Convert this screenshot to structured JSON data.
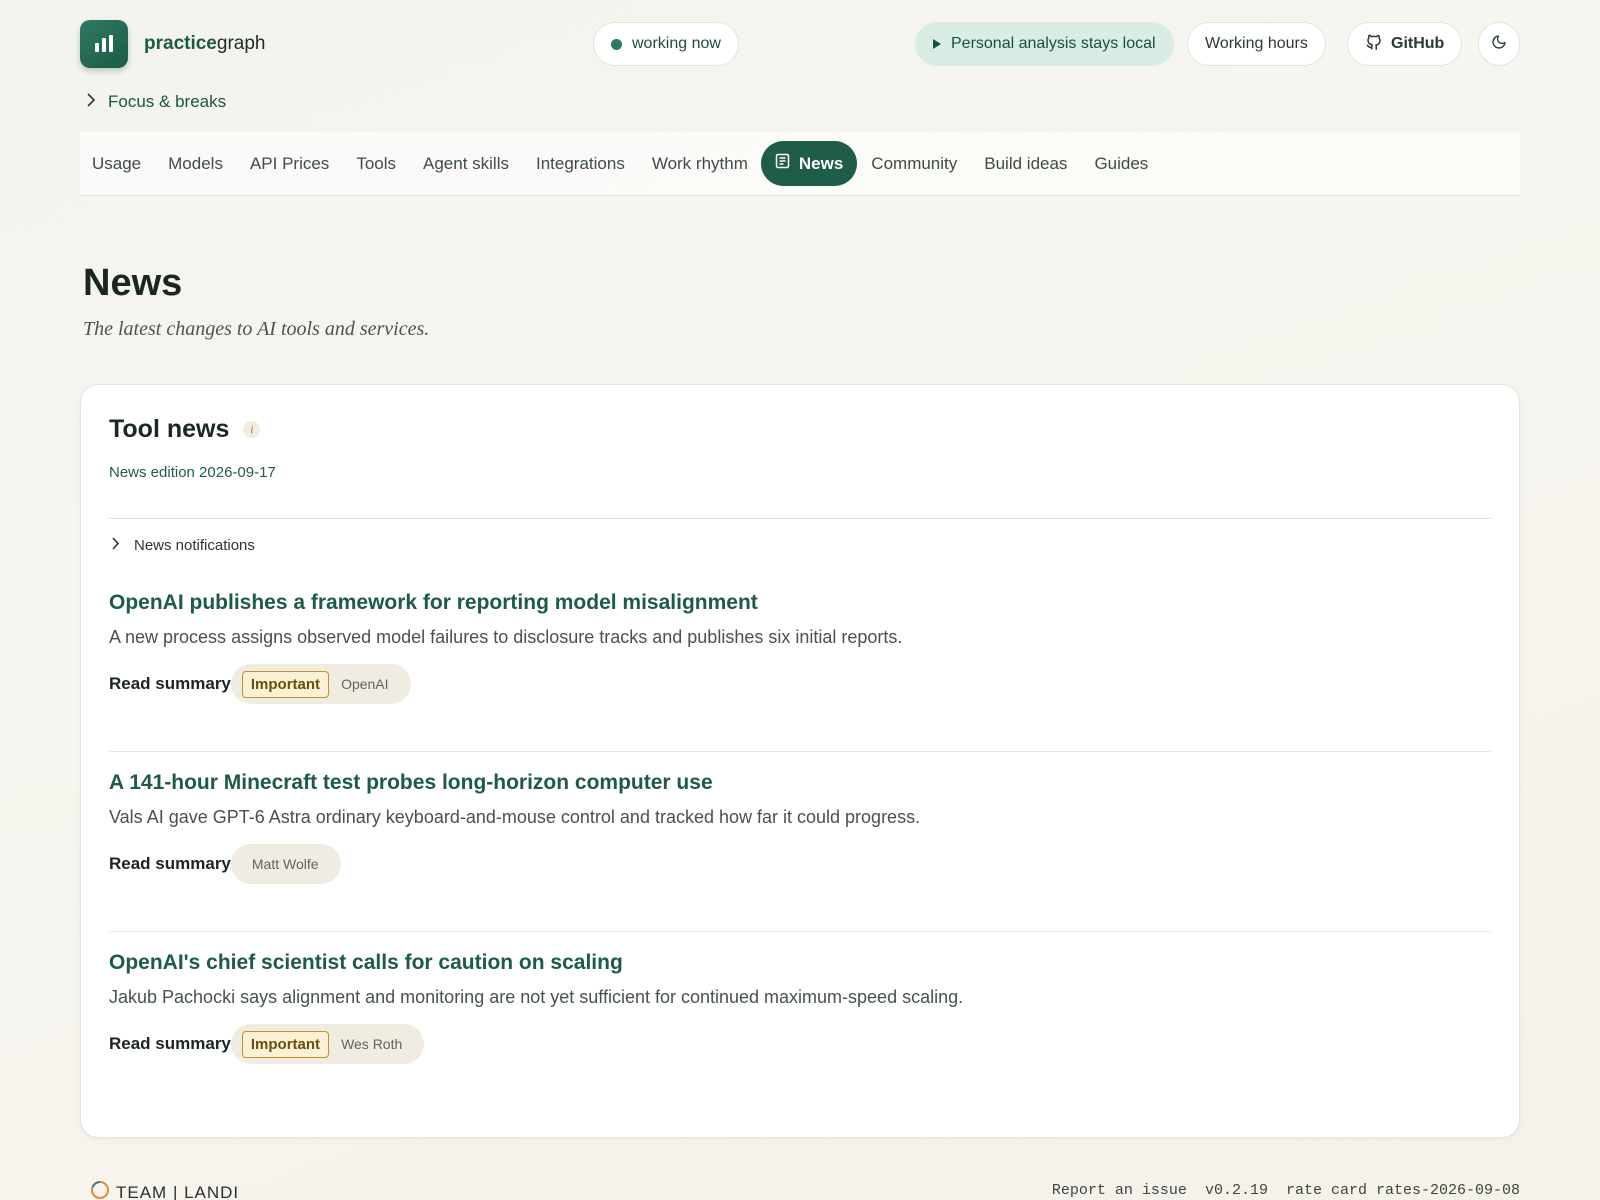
{
  "brand": {
    "name_bold": "practice",
    "name_rest": "graph"
  },
  "header": {
    "status": "working now",
    "privacy": "Personal analysis stays local",
    "hours": "Working hours",
    "github": "GitHub"
  },
  "breadcrumb": {
    "label": "Focus & breaks"
  },
  "nav": {
    "items": [
      "Usage",
      "Models",
      "API Prices",
      "Tools",
      "Agent skills",
      "Integrations",
      "Work rhythm",
      "News",
      "Community",
      "Build ideas",
      "Guides"
    ]
  },
  "page": {
    "title": "News",
    "subtitle": "The latest changes to AI tools and services."
  },
  "card": {
    "title": "Tool news",
    "info": "i",
    "edition": "News edition 2026-09-17",
    "notifications": "News notifications",
    "items": [
      {
        "title": "OpenAI publishes a framework for reporting model misalignment",
        "desc": "A new process assigns observed model failures to disclosure tracks and publishes six initial reports.",
        "read": "Read summary",
        "badge": "Important",
        "source": "OpenAI"
      },
      {
        "title": "A 141-hour Minecraft test probes long-horizon computer use",
        "desc": "Vals AI gave GPT-6 Astra ordinary keyboard-and-mouse control and tracked how far it could progress.",
        "read": "Read summary",
        "source": "Matt Wolfe"
      },
      {
        "title": "OpenAI's chief scientist calls for caution on scaling",
        "desc": "Jakub Pachocki says alignment and monitoring are not yet sufficient for continued maximum-speed scaling.",
        "read": "Read summary",
        "badge": "Important",
        "source": "Wes Roth"
      }
    ]
  },
  "footer": {
    "logo": "TEAM | LANDI",
    "report": "Report an issue",
    "version": "v0.2.19",
    "rate_card": "rate card rates-2026-09-08"
  },
  "colors": {
    "accent": "#1f5c4a",
    "accent_light": "#d9ede4",
    "badge_border": "#c0912c"
  }
}
